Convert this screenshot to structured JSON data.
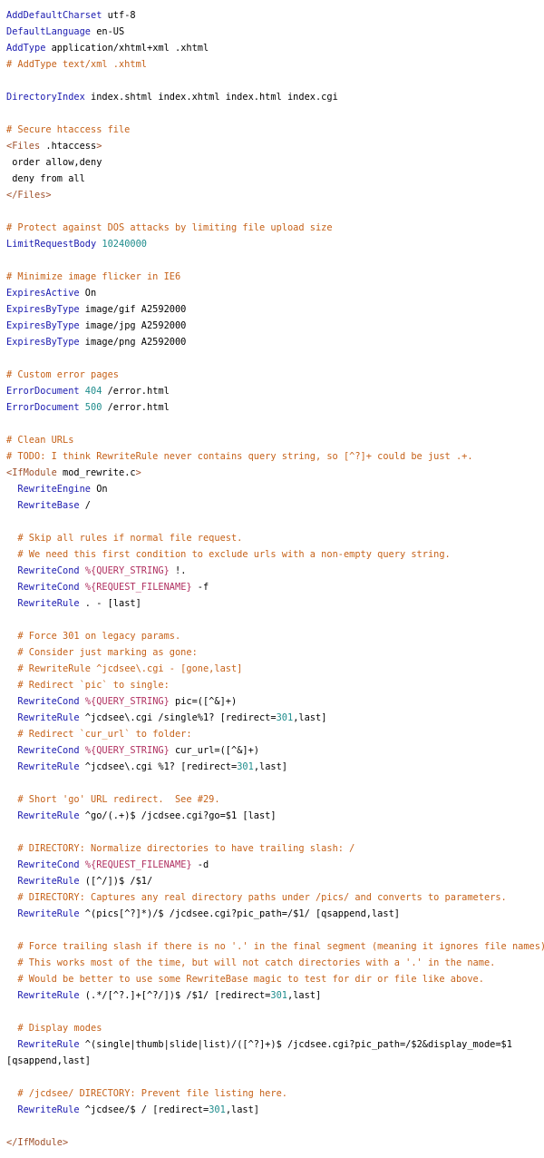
{
  "code": {
    "lines": [
      [
        {
          "t": "kw",
          "v": "AddDefaultCharset"
        },
        {
          "t": "plain",
          "v": " utf-8"
        }
      ],
      [
        {
          "t": "kw",
          "v": "DefaultLanguage"
        },
        {
          "t": "plain",
          "v": " en-US"
        }
      ],
      [
        {
          "t": "kw",
          "v": "AddType"
        },
        {
          "t": "plain",
          "v": " application/xhtml+xml .xhtml"
        }
      ],
      [
        {
          "t": "cmt",
          "v": "# AddType text/xml .xhtml"
        }
      ],
      [],
      [
        {
          "t": "kw",
          "v": "DirectoryIndex"
        },
        {
          "t": "plain",
          "v": " index.shtml index.xhtml index.html index.cgi"
        }
      ],
      [],
      [
        {
          "t": "cmt",
          "v": "# Secure htaccess file"
        }
      ],
      [
        {
          "t": "tag",
          "v": "<Files"
        },
        {
          "t": "plain",
          "v": " .htaccess"
        },
        {
          "t": "tag",
          "v": ">"
        }
      ],
      [
        {
          "t": "plain",
          "v": " order allow,deny"
        }
      ],
      [
        {
          "t": "plain",
          "v": " deny from all"
        }
      ],
      [
        {
          "t": "tag",
          "v": "</Files>"
        }
      ],
      [],
      [
        {
          "t": "cmt",
          "v": "# Protect against DOS attacks by limiting file upload size"
        }
      ],
      [
        {
          "t": "kw",
          "v": "LimitRequestBody"
        },
        {
          "t": "plain",
          "v": " "
        },
        {
          "t": "num",
          "v": "10240000"
        }
      ],
      [],
      [
        {
          "t": "cmt",
          "v": "# Minimize image flicker in IE6"
        }
      ],
      [
        {
          "t": "kw",
          "v": "ExpiresActive"
        },
        {
          "t": "plain",
          "v": " On"
        }
      ],
      [
        {
          "t": "kw",
          "v": "ExpiresByType"
        },
        {
          "t": "plain",
          "v": " image/gif A2592000"
        }
      ],
      [
        {
          "t": "kw",
          "v": "ExpiresByType"
        },
        {
          "t": "plain",
          "v": " image/jpg A2592000"
        }
      ],
      [
        {
          "t": "kw",
          "v": "ExpiresByType"
        },
        {
          "t": "plain",
          "v": " image/png A2592000"
        }
      ],
      [],
      [
        {
          "t": "cmt",
          "v": "# Custom error pages"
        }
      ],
      [
        {
          "t": "kw",
          "v": "ErrorDocument"
        },
        {
          "t": "plain",
          "v": " "
        },
        {
          "t": "num",
          "v": "404"
        },
        {
          "t": "plain",
          "v": " /error.html"
        }
      ],
      [
        {
          "t": "kw",
          "v": "ErrorDocument"
        },
        {
          "t": "plain",
          "v": " "
        },
        {
          "t": "num",
          "v": "500"
        },
        {
          "t": "plain",
          "v": " /error.html"
        }
      ],
      [],
      [
        {
          "t": "cmt",
          "v": "# Clean URLs"
        }
      ],
      [
        {
          "t": "cmt",
          "v": "# TODO: I think RewriteRule never contains query string, so [^?]+ could be just .+."
        }
      ],
      [
        {
          "t": "tag",
          "v": "<IfModule"
        },
        {
          "t": "plain",
          "v": " mod_rewrite.c"
        },
        {
          "t": "tag",
          "v": ">"
        }
      ],
      [
        {
          "t": "plain",
          "v": "  "
        },
        {
          "t": "kw",
          "v": "RewriteEngine"
        },
        {
          "t": "plain",
          "v": " On"
        }
      ],
      [
        {
          "t": "plain",
          "v": "  "
        },
        {
          "t": "kw",
          "v": "RewriteBase"
        },
        {
          "t": "plain",
          "v": " /"
        }
      ],
      [],
      [
        {
          "t": "plain",
          "v": "  "
        },
        {
          "t": "cmt",
          "v": "# Skip all rules if normal file request."
        }
      ],
      [
        {
          "t": "plain",
          "v": "  "
        },
        {
          "t": "cmt",
          "v": "# We need this first condition to exclude urls with a non-empty query string."
        }
      ],
      [
        {
          "t": "plain",
          "v": "  "
        },
        {
          "t": "kw",
          "v": "RewriteCond"
        },
        {
          "t": "plain",
          "v": " "
        },
        {
          "t": "var",
          "v": "%{QUERY_STRING}"
        },
        {
          "t": "plain",
          "v": " !."
        }
      ],
      [
        {
          "t": "plain",
          "v": "  "
        },
        {
          "t": "kw",
          "v": "RewriteCond"
        },
        {
          "t": "plain",
          "v": " "
        },
        {
          "t": "var",
          "v": "%{REQUEST_FILENAME}"
        },
        {
          "t": "plain",
          "v": " -f"
        }
      ],
      [
        {
          "t": "plain",
          "v": "  "
        },
        {
          "t": "kw",
          "v": "RewriteRule"
        },
        {
          "t": "plain",
          "v": " . - [last]"
        }
      ],
      [],
      [
        {
          "t": "plain",
          "v": "  "
        },
        {
          "t": "cmt",
          "v": "# Force 301 on legacy params."
        }
      ],
      [
        {
          "t": "plain",
          "v": "  "
        },
        {
          "t": "cmt",
          "v": "# Consider just marking as gone:"
        }
      ],
      [
        {
          "t": "plain",
          "v": "  "
        },
        {
          "t": "cmt",
          "v": "# RewriteRule ^jcdsee\\.cgi - [gone,last]"
        }
      ],
      [
        {
          "t": "plain",
          "v": "  "
        },
        {
          "t": "cmt",
          "v": "# Redirect `pic` to single:"
        }
      ],
      [
        {
          "t": "plain",
          "v": "  "
        },
        {
          "t": "kw",
          "v": "RewriteCond"
        },
        {
          "t": "plain",
          "v": " "
        },
        {
          "t": "var",
          "v": "%{QUERY_STRING}"
        },
        {
          "t": "plain",
          "v": " pic=([^&]+)"
        }
      ],
      [
        {
          "t": "plain",
          "v": "  "
        },
        {
          "t": "kw",
          "v": "RewriteRule"
        },
        {
          "t": "plain",
          "v": " ^jcdsee\\.cgi /single%1? [redirect="
        },
        {
          "t": "num",
          "v": "301"
        },
        {
          "t": "plain",
          "v": ",last]"
        }
      ],
      [
        {
          "t": "plain",
          "v": "  "
        },
        {
          "t": "cmt",
          "v": "# Redirect `cur_url` to folder:"
        }
      ],
      [
        {
          "t": "plain",
          "v": "  "
        },
        {
          "t": "kw",
          "v": "RewriteCond"
        },
        {
          "t": "plain",
          "v": " "
        },
        {
          "t": "var",
          "v": "%{QUERY_STRING}"
        },
        {
          "t": "plain",
          "v": " cur_url=([^&]+)"
        }
      ],
      [
        {
          "t": "plain",
          "v": "  "
        },
        {
          "t": "kw",
          "v": "RewriteRule"
        },
        {
          "t": "plain",
          "v": " ^jcdsee\\.cgi %1? [redirect="
        },
        {
          "t": "num",
          "v": "301"
        },
        {
          "t": "plain",
          "v": ",last]"
        }
      ],
      [],
      [
        {
          "t": "plain",
          "v": "  "
        },
        {
          "t": "cmt",
          "v": "# Short 'go' URL redirect.  See #29."
        }
      ],
      [
        {
          "t": "plain",
          "v": "  "
        },
        {
          "t": "kw",
          "v": "RewriteRule"
        },
        {
          "t": "plain",
          "v": " ^go/(.+)$ /jcdsee.cgi?go=$1 [last]"
        }
      ],
      [],
      [
        {
          "t": "plain",
          "v": "  "
        },
        {
          "t": "cmt",
          "v": "# DIRECTORY: Normalize directories to have trailing slash: /"
        }
      ],
      [
        {
          "t": "plain",
          "v": "  "
        },
        {
          "t": "kw",
          "v": "RewriteCond"
        },
        {
          "t": "plain",
          "v": " "
        },
        {
          "t": "var",
          "v": "%{REQUEST_FILENAME}"
        },
        {
          "t": "plain",
          "v": " -d"
        }
      ],
      [
        {
          "t": "plain",
          "v": "  "
        },
        {
          "t": "kw",
          "v": "RewriteRule"
        },
        {
          "t": "plain",
          "v": " ([^/])$ /$1/"
        }
      ],
      [
        {
          "t": "plain",
          "v": "  "
        },
        {
          "t": "cmt",
          "v": "# DIRECTORY: Captures any real directory paths under /pics/ and converts to parameters."
        }
      ],
      [
        {
          "t": "plain",
          "v": "  "
        },
        {
          "t": "kw",
          "v": "RewriteRule"
        },
        {
          "t": "plain",
          "v": " ^(pics[^?]*)/$ /jcdsee.cgi?pic_path=/$1/ [qsappend,last]"
        }
      ],
      [],
      [
        {
          "t": "plain",
          "v": "  "
        },
        {
          "t": "cmt",
          "v": "# Force trailing slash if there is no '.' in the final segment (meaning it ignores file names)."
        }
      ],
      [
        {
          "t": "plain",
          "v": "  "
        },
        {
          "t": "cmt",
          "v": "# This works most of the time, but will not catch directories with a '.' in the name."
        }
      ],
      [
        {
          "t": "plain",
          "v": "  "
        },
        {
          "t": "cmt",
          "v": "# Would be better to use some RewriteBase magic to test for dir or file like above."
        }
      ],
      [
        {
          "t": "plain",
          "v": "  "
        },
        {
          "t": "kw",
          "v": "RewriteRule"
        },
        {
          "t": "plain",
          "v": " (.*/[^?.]+[^?/])$ /$1/ [redirect="
        },
        {
          "t": "num",
          "v": "301"
        },
        {
          "t": "plain",
          "v": ",last]"
        }
      ],
      [],
      [
        {
          "t": "plain",
          "v": "  "
        },
        {
          "t": "cmt",
          "v": "# Display modes"
        }
      ],
      [
        {
          "t": "plain",
          "v": "  "
        },
        {
          "t": "kw",
          "v": "RewriteRule"
        },
        {
          "t": "plain",
          "v": " ^(single|thumb|slide|list)/([^?]+)$ /jcdsee.cgi?pic_path=/$2&display_mode=$1"
        }
      ],
      [
        {
          "t": "plain",
          "v": "[qsappend,last]"
        }
      ],
      [],
      [
        {
          "t": "plain",
          "v": "  "
        },
        {
          "t": "cmt",
          "v": "# /jcdsee/ DIRECTORY: Prevent file listing here."
        }
      ],
      [
        {
          "t": "plain",
          "v": "  "
        },
        {
          "t": "kw",
          "v": "RewriteRule"
        },
        {
          "t": "plain",
          "v": " ^jcdsee/$ / [redirect="
        },
        {
          "t": "num",
          "v": "301"
        },
        {
          "t": "plain",
          "v": ",last]"
        }
      ],
      [],
      [
        {
          "t": "tag",
          "v": "</IfModule>"
        }
      ]
    ]
  }
}
